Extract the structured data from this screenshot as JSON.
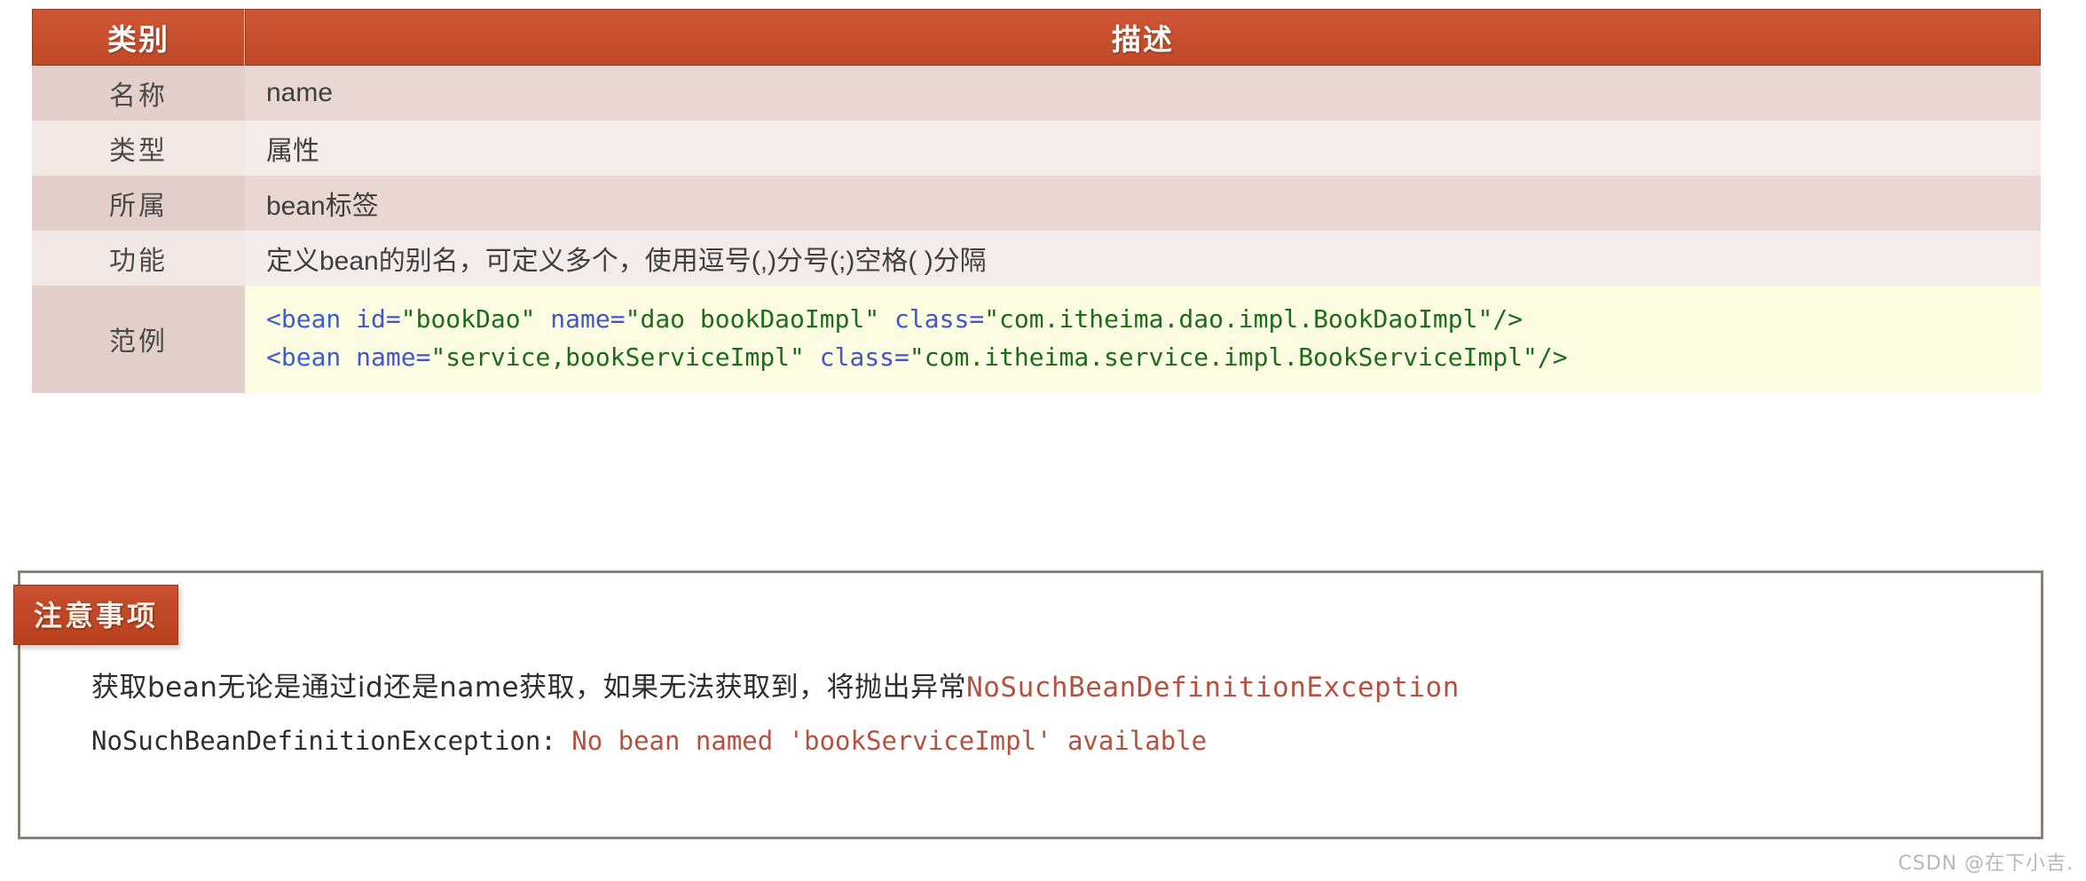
{
  "table": {
    "headers": [
      "类别",
      "描述"
    ],
    "rows": [
      {
        "label": "名称",
        "value": "name"
      },
      {
        "label": "类型",
        "value": "属性"
      },
      {
        "label": "所属",
        "value": "bean标签"
      },
      {
        "label": "功能",
        "value": "定义bean的别名，可定义多个，使用逗号(,)分号(;)空格( )分隔"
      }
    ],
    "sample": {
      "label": "范例",
      "lines": [
        {
          "t1": "<bean ",
          "a1": "id=",
          "s1": "\"bookDao\"",
          "a2": " name=",
          "s2": "\"dao bookDaoImpl\"",
          "a3": " class=",
          "s3": "\"com.itheima.dao.impl.BookDaoImpl\"/>"
        },
        {
          "t1": "<bean ",
          "a1": "name=",
          "s1": "\"service,bookServiceImpl\"",
          "a2": " class=",
          "s2": "\"com.itheima.service.impl.BookServiceImpl\"/>",
          "a3": "",
          "s3": ""
        }
      ]
    }
  },
  "notice": {
    "tab_label": "注意事项",
    "line1_prefix": "获取bean无论是通过id还是name获取，如果无法获取到，将抛出异常",
    "line1_exception": "NoSuchBeanDefinitionException",
    "line2_prefix": "NoSuchBeanDefinitionException: ",
    "line2_message": "No bean named 'bookServiceImpl' available"
  },
  "watermark": "CSDN @在下小吉.",
  "colors": {
    "header_bg": "#c9522f",
    "notice_tab_bg": "#c24a26",
    "row_dark": "#e3d0cb",
    "row_light": "#f2e8e6",
    "code_bg": "#fcfce2",
    "exception_red": "#b4523f",
    "code_tag_blue": "#3a5fcd",
    "code_string_green": "#1d6b1d"
  }
}
